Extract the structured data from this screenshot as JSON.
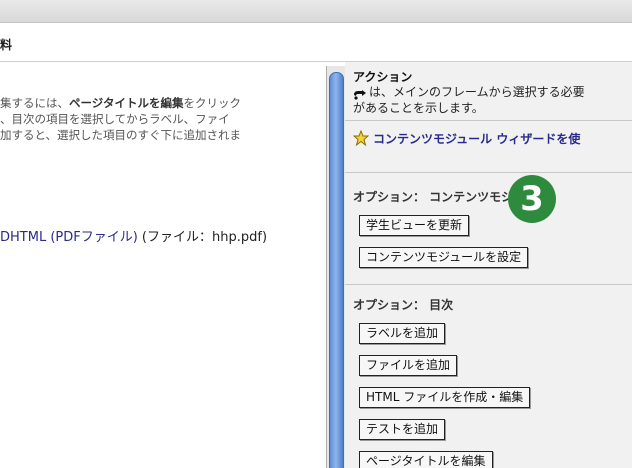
{
  "page": {
    "title": "料"
  },
  "left": {
    "desc_line1_a": "集するには、",
    "desc_line1_b": "ページタイトルを編集",
    "desc_line1_c": "をクリック",
    "desc_line2": "、目次の項目を選択してからラベル、ファイ",
    "desc_line3": "加すると、選択した項目のすぐ下に追加されま",
    "file_link": "DHTML (PDFファイル)",
    "file_info": " (ファイル：hhp.pdf)"
  },
  "actions": {
    "header": "アクション",
    "desc_line1": "は、メインのフレームから選択する必要",
    "desc_line2": "があることを示します。",
    "wizard_link": "コンテンツモジュール ウィザードを使",
    "content_options_label": "オプション： コンテンツモジュール",
    "btn_update_student_view": "学生ビューを更新",
    "btn_set_content_module": "コンテンツモジュールを設定",
    "toc_options_label": "オプション： 目次",
    "btn_add_label": "ラベルを追加",
    "btn_add_file": "ファイルを追加",
    "btn_create_edit_html": "HTML ファイルを作成・編集",
    "btn_add_test": "テストを追加",
    "btn_edit_page_title": "ページタイトルを編集"
  },
  "badge": {
    "number": "3",
    "color": "#2e8b3e"
  },
  "colors": {
    "link": "#2a2a8c",
    "panel_bg": "#f1f1f1",
    "scroll_thumb": "#5d8fd8"
  }
}
